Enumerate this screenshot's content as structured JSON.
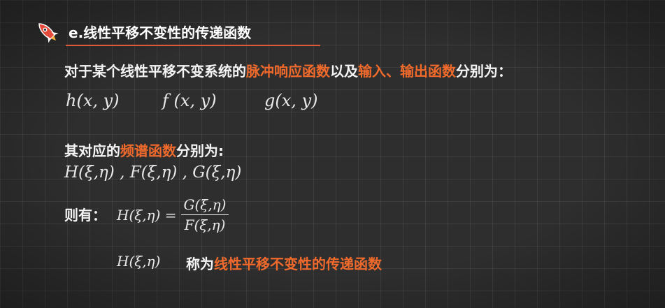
{
  "heading": "e.线性平移不变性的传递函数",
  "line1": {
    "a": "对于某个线性平移不变系统的",
    "b": "脉冲响应函数",
    "c": "以及",
    "d": "输入、输出函数",
    "e": "分别为："
  },
  "functions": [
    "h(x, y)",
    "f (x, y)",
    "g(x, y)"
  ],
  "line2": {
    "a": "其对应的",
    "b": "频谱函数",
    "c": "分别为:"
  },
  "spectra": "H(ξ,η) , F(ξ,η) ,  G(ξ,η)",
  "then_label": "则有：",
  "equation": {
    "lhs": "H(ξ,η) =",
    "numerator": "G(ξ,η)",
    "denominator": "F(ξ,η)"
  },
  "last": {
    "symbol": "H(ξ,η)",
    "a": "称为",
    "b": "线性平移不变性的传递函数"
  },
  "colors": {
    "accent": "#f06a2c",
    "underline": "#e0583a",
    "background": "#2e2e2e"
  },
  "icon": "rocket-icon"
}
